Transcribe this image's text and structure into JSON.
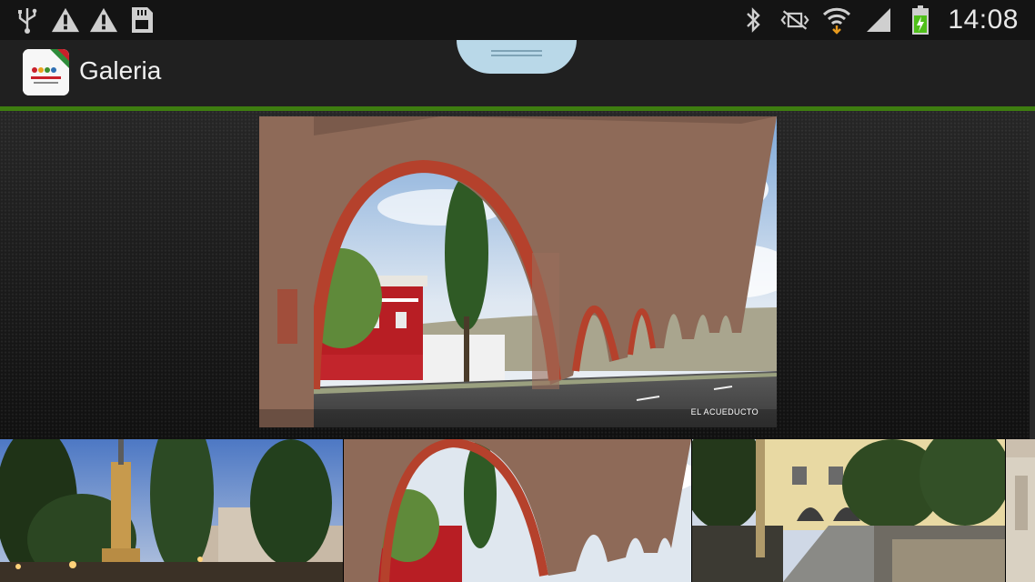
{
  "status_bar": {
    "left_icons": [
      "usb-icon",
      "warning-icon",
      "warning-icon",
      "sd-card-icon"
    ],
    "right_icons": [
      "bluetooth-icon",
      "vibrate-icon",
      "wifi-icon",
      "signal-icon",
      "battery-charging-icon"
    ],
    "time": "14:08"
  },
  "action_bar": {
    "title": "Galeria",
    "app_icon_text": "QUERÉTARO",
    "accent_color": "#3e7d10"
  },
  "main_image": {
    "caption": "EL ACUEDUCTO"
  },
  "thumbnails": [
    {
      "name": "plaza-monument-night"
    },
    {
      "name": "aqueduct"
    },
    {
      "name": "colonial-plaza"
    },
    {
      "name": "building-partial"
    }
  ]
}
